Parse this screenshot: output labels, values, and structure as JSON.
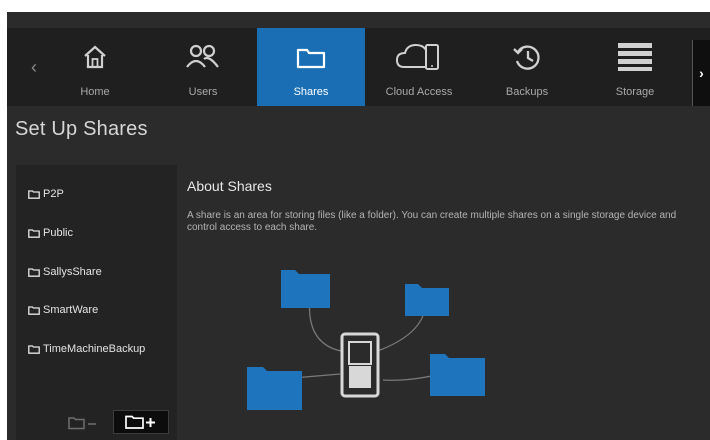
{
  "nav": {
    "items": [
      {
        "label": "Home",
        "icon": "home-icon"
      },
      {
        "label": "Users",
        "icon": "users-icon"
      },
      {
        "label": "Shares",
        "icon": "folder-icon"
      },
      {
        "label": "Cloud Access",
        "icon": "cloud-device-icon"
      },
      {
        "label": "Backups",
        "icon": "backup-clock-icon"
      },
      {
        "label": "Storage",
        "icon": "storage-icon"
      }
    ],
    "active": "Shares",
    "prev_glyph": "‹",
    "next_glyph": "›"
  },
  "page": {
    "title": "Set Up Shares"
  },
  "shares": [
    {
      "label": "P2P"
    },
    {
      "label": "Public"
    },
    {
      "label": "SallysShare"
    },
    {
      "label": "SmartWare"
    },
    {
      "label": "TimeMachineBackup"
    }
  ],
  "about": {
    "title": "About Shares",
    "text": "A share is an area for storing files (like a folder). You can create multiple shares on a single storage device and control access to each share."
  },
  "colors": {
    "accent": "#1a6fb4",
    "folder": "#1f74be",
    "background": "#2b2b2b",
    "nav_bar": "#1f1f1f"
  }
}
